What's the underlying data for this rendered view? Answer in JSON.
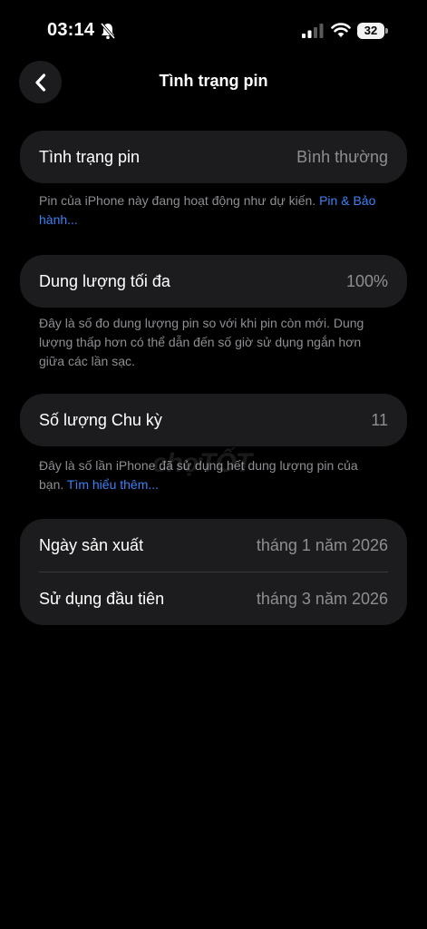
{
  "status_bar": {
    "time": "03:14",
    "battery_level": "32",
    "icons": [
      "bell-slash-icon",
      "cellular-signal-icon",
      "wifi-icon",
      "battery-icon"
    ]
  },
  "nav": {
    "back_icon": "chevron-left-icon",
    "title": "Tình trạng pin"
  },
  "health": {
    "label": "Tình trạng pin",
    "value": "Bình thường",
    "note": "Pin của iPhone này đang hoạt động như dự kiến. ",
    "note_link": "Pin & Bảo hành..."
  },
  "capacity": {
    "label": "Dung lượng tối đa",
    "value": "100%",
    "note": "Đây là số đo dung lượng pin so với khi pin còn mới. Dung lượng thấp hơn có thể dẫn đến số giờ sử dụng ngắn hơn giữa các lần sạc."
  },
  "cycles": {
    "label": "Số lượng Chu kỳ",
    "value": "11",
    "note": "Đây là số lần iPhone đã sử dụng hết dung lượng pin của bạn. ",
    "note_link": "Tìm hiểu thêm..."
  },
  "dates": {
    "manufacture_label": "Ngày sản xuất",
    "manufacture_value": "tháng 1 năm 2026",
    "first_use_label": "Sử dụng đầu tiên",
    "first_use_value": "tháng 3 năm 2026"
  },
  "watermark": "chợTỐT",
  "colors": {
    "background": "#000000",
    "card": "#1c1c1e",
    "secondary_text": "#8e8e93",
    "link": "#3b82f6"
  }
}
